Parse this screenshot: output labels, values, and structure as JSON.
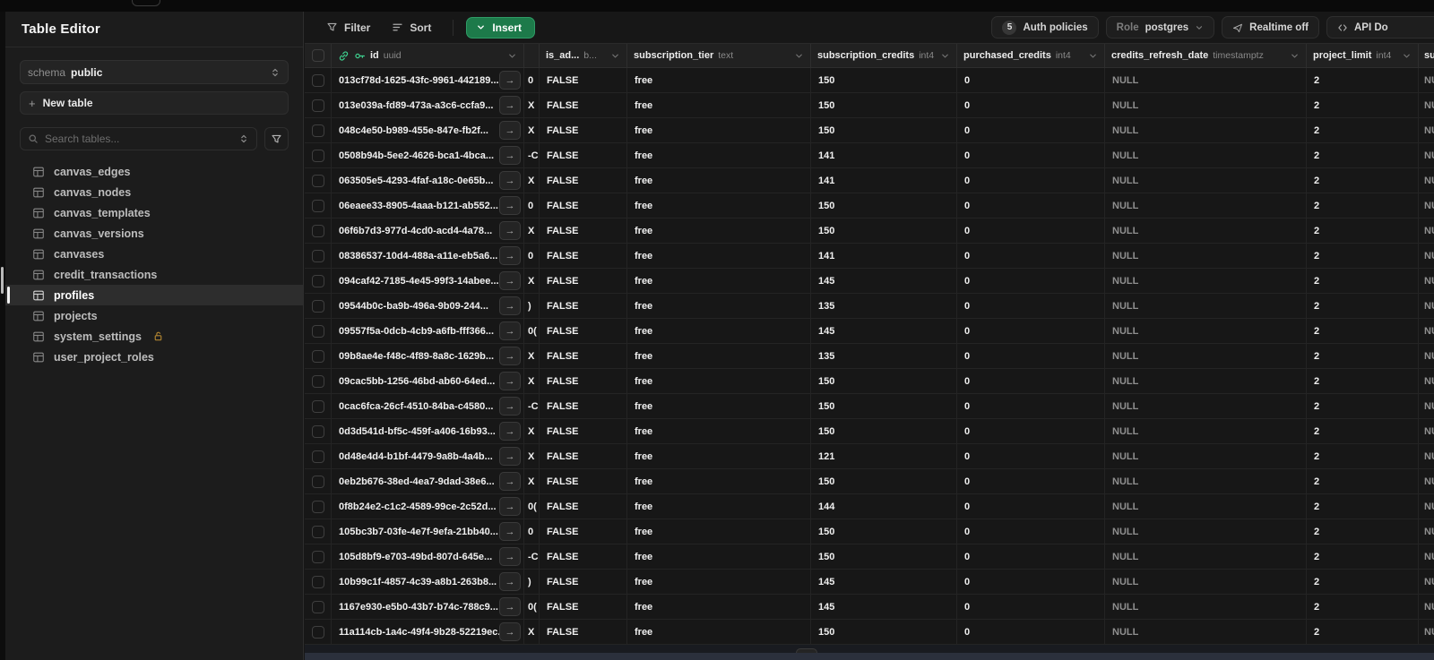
{
  "sidebar": {
    "title": "Table Editor",
    "schema_label": "schema",
    "schema_value": "public",
    "new_table_label": "New table",
    "search_placeholder": "Search tables...",
    "tables": [
      {
        "name": "canvas_edges",
        "selected": false,
        "locked": false
      },
      {
        "name": "canvas_nodes",
        "selected": false,
        "locked": false
      },
      {
        "name": "canvas_templates",
        "selected": false,
        "locked": false
      },
      {
        "name": "canvas_versions",
        "selected": false,
        "locked": false
      },
      {
        "name": "canvases",
        "selected": false,
        "locked": false
      },
      {
        "name": "credit_transactions",
        "selected": false,
        "locked": false
      },
      {
        "name": "profiles",
        "selected": true,
        "locked": false
      },
      {
        "name": "projects",
        "selected": false,
        "locked": false
      },
      {
        "name": "system_settings",
        "selected": false,
        "locked": true
      },
      {
        "name": "user_project_roles",
        "selected": false,
        "locked": false
      }
    ]
  },
  "toolbar": {
    "filter_label": "Filter",
    "sort_label": "Sort",
    "insert_label": "Insert",
    "auth_policies_count": "5",
    "auth_policies_label": "Auth policies",
    "role_label": "Role",
    "role_value": "postgres",
    "realtime_label": "Realtime off",
    "api_label": "API Do"
  },
  "grid": {
    "columns": [
      {
        "name": "id",
        "type": "uuid"
      },
      {
        "name": "",
        "type": ""
      },
      {
        "name": "is_ad...",
        "type": "b..."
      },
      {
        "name": "subscription_tier",
        "type": "text"
      },
      {
        "name": "subscription_credits",
        "type": "int4"
      },
      {
        "name": "purchased_credits",
        "type": "int4"
      },
      {
        "name": "credits_refresh_date",
        "type": "timestamptz"
      },
      {
        "name": "project_limit",
        "type": "int4"
      },
      {
        "name": "su",
        "type": ""
      }
    ],
    "rows": [
      {
        "id": "013cf78d-1625-43fc-9961-442189...",
        "frag": "0",
        "is_admin": "FALSE",
        "tier": "free",
        "sub_credits": "150",
        "purchased": "0",
        "refresh": "NULL",
        "limit": "2",
        "partial": "NU"
      },
      {
        "id": "013e039a-fd89-473a-a3c6-ccfa9...",
        "frag": "X",
        "is_admin": "FALSE",
        "tier": "free",
        "sub_credits": "150",
        "purchased": "0",
        "refresh": "NULL",
        "limit": "2",
        "partial": "NU"
      },
      {
        "id": "048c4e50-b989-455e-847e-fb2f...",
        "frag": "X",
        "is_admin": "FALSE",
        "tier": "free",
        "sub_credits": "150",
        "purchased": "0",
        "refresh": "NULL",
        "limit": "2",
        "partial": "NU"
      },
      {
        "id": "0508b94b-5ee2-4626-bca1-4bca...",
        "frag": "-C",
        "is_admin": "FALSE",
        "tier": "free",
        "sub_credits": "141",
        "purchased": "0",
        "refresh": "NULL",
        "limit": "2",
        "partial": "NU"
      },
      {
        "id": "063505e5-4293-4faf-a18c-0e65b...",
        "frag": "X",
        "is_admin": "FALSE",
        "tier": "free",
        "sub_credits": "141",
        "purchased": "0",
        "refresh": "NULL",
        "limit": "2",
        "partial": "NU"
      },
      {
        "id": "06eaee33-8905-4aaa-b121-ab552...",
        "frag": "0",
        "is_admin": "FALSE",
        "tier": "free",
        "sub_credits": "150",
        "purchased": "0",
        "refresh": "NULL",
        "limit": "2",
        "partial": "NU"
      },
      {
        "id": "06f6b7d3-977d-4cd0-acd4-4a78...",
        "frag": "X",
        "is_admin": "FALSE",
        "tier": "free",
        "sub_credits": "150",
        "purchased": "0",
        "refresh": "NULL",
        "limit": "2",
        "partial": "NU"
      },
      {
        "id": "08386537-10d4-488a-a11e-eb5a6...",
        "frag": "0",
        "is_admin": "FALSE",
        "tier": "free",
        "sub_credits": "141",
        "purchased": "0",
        "refresh": "NULL",
        "limit": "2",
        "partial": "NU"
      },
      {
        "id": "094caf42-7185-4e45-99f3-14abee...",
        "frag": "X",
        "is_admin": "FALSE",
        "tier": "free",
        "sub_credits": "145",
        "purchased": "0",
        "refresh": "NULL",
        "limit": "2",
        "partial": "NU"
      },
      {
        "id": "09544b0c-ba9b-496a-9b09-244...",
        "frag": ")",
        "is_admin": "FALSE",
        "tier": "free",
        "sub_credits": "135",
        "purchased": "0",
        "refresh": "NULL",
        "limit": "2",
        "partial": "NU"
      },
      {
        "id": "09557f5a-0dcb-4cb9-a6fb-fff366...",
        "frag": "0(",
        "is_admin": "FALSE",
        "tier": "free",
        "sub_credits": "145",
        "purchased": "0",
        "refresh": "NULL",
        "limit": "2",
        "partial": "NU"
      },
      {
        "id": "09b8ae4e-f48c-4f89-8a8c-1629b...",
        "frag": "X",
        "is_admin": "FALSE",
        "tier": "free",
        "sub_credits": "135",
        "purchased": "0",
        "refresh": "NULL",
        "limit": "2",
        "partial": "NU"
      },
      {
        "id": "09cac5bb-1256-46bd-ab60-64ed...",
        "frag": "X",
        "is_admin": "FALSE",
        "tier": "free",
        "sub_credits": "150",
        "purchased": "0",
        "refresh": "NULL",
        "limit": "2",
        "partial": "NU"
      },
      {
        "id": "0cac6fca-26cf-4510-84ba-c4580...",
        "frag": "-C",
        "is_admin": "FALSE",
        "tier": "free",
        "sub_credits": "150",
        "purchased": "0",
        "refresh": "NULL",
        "limit": "2",
        "partial": "NU"
      },
      {
        "id": "0d3d541d-bf5c-459f-a406-16b93...",
        "frag": "X",
        "is_admin": "FALSE",
        "tier": "free",
        "sub_credits": "150",
        "purchased": "0",
        "refresh": "NULL",
        "limit": "2",
        "partial": "NU"
      },
      {
        "id": "0d48e4d4-b1bf-4479-9a8b-4a4b...",
        "frag": "X",
        "is_admin": "FALSE",
        "tier": "free",
        "sub_credits": "121",
        "purchased": "0",
        "refresh": "NULL",
        "limit": "2",
        "partial": "NU"
      },
      {
        "id": "0eb2b676-38ed-4ea7-9dad-38e6...",
        "frag": "X",
        "is_admin": "FALSE",
        "tier": "free",
        "sub_credits": "150",
        "purchased": "0",
        "refresh": "NULL",
        "limit": "2",
        "partial": "NU"
      },
      {
        "id": "0f8b24e2-c1c2-4589-99ce-2c52d...",
        "frag": "0(",
        "is_admin": "FALSE",
        "tier": "free",
        "sub_credits": "144",
        "purchased": "0",
        "refresh": "NULL",
        "limit": "2",
        "partial": "NU"
      },
      {
        "id": "105bc3b7-03fe-4e7f-9efa-21bb40...",
        "frag": "0",
        "is_admin": "FALSE",
        "tier": "free",
        "sub_credits": "150",
        "purchased": "0",
        "refresh": "NULL",
        "limit": "2",
        "partial": "NU"
      },
      {
        "id": "105d8bf9-e703-49bd-807d-645e...",
        "frag": "-C",
        "is_admin": "FALSE",
        "tier": "free",
        "sub_credits": "150",
        "purchased": "0",
        "refresh": "NULL",
        "limit": "2",
        "partial": "NU"
      },
      {
        "id": "10b99c1f-4857-4c39-a8b1-263b8...",
        "frag": ")",
        "is_admin": "FALSE",
        "tier": "free",
        "sub_credits": "145",
        "purchased": "0",
        "refresh": "NULL",
        "limit": "2",
        "partial": "NU"
      },
      {
        "id": "1167e930-e5b0-43b7-b74c-788c9...",
        "frag": "0(",
        "is_admin": "FALSE",
        "tier": "free",
        "sub_credits": "145",
        "purchased": "0",
        "refresh": "NULL",
        "limit": "2",
        "partial": "NU"
      },
      {
        "id": "11a114cb-1a4c-49f4-9b28-52219ec...",
        "frag": "X",
        "is_admin": "FALSE",
        "tier": "free",
        "sub_credits": "150",
        "purchased": "0",
        "refresh": "NULL",
        "limit": "2",
        "partial": "NU"
      }
    ]
  },
  "colors": {
    "accent_green": "#3ecf8e",
    "insert_button": "#1d7a4a",
    "lock_amber": "#b08430"
  }
}
